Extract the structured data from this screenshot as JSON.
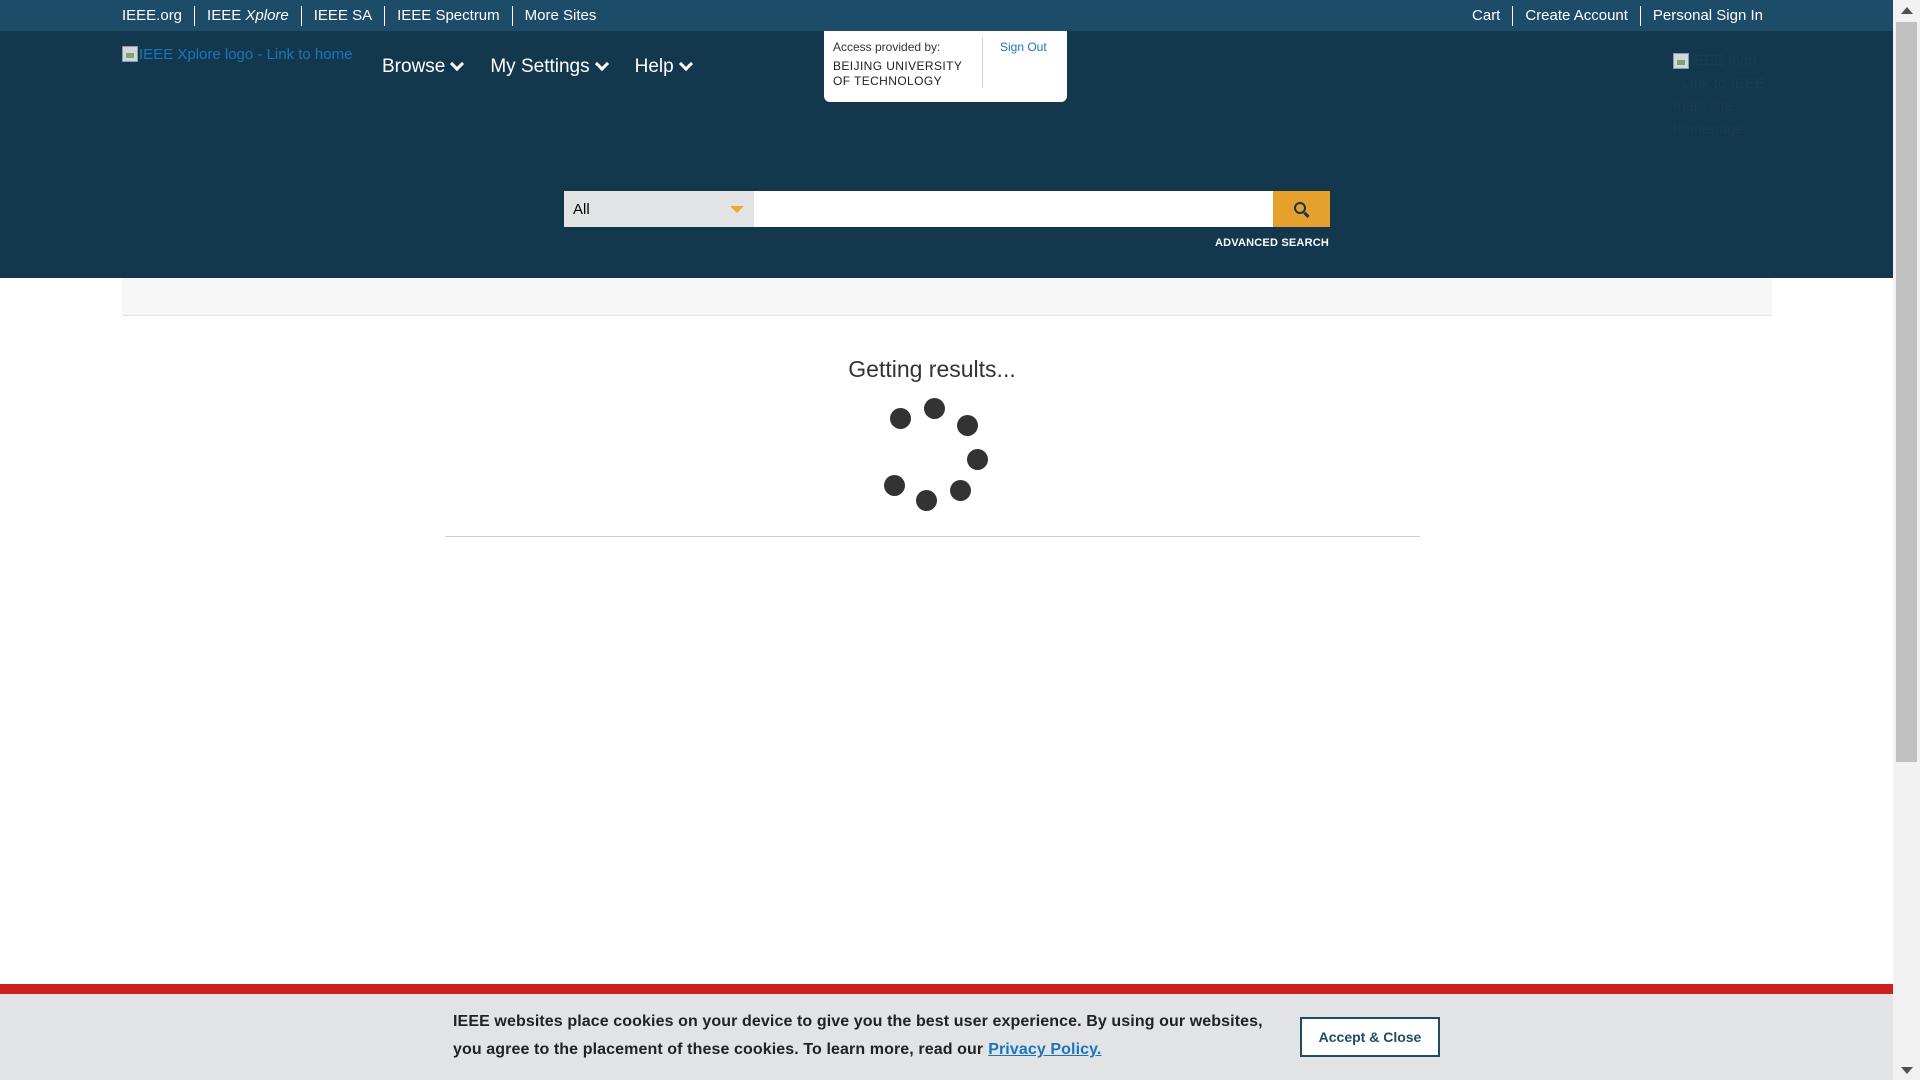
{
  "topbar": {
    "left_links": [
      {
        "label": "IEEE.org"
      },
      {
        "label_prefix": "IEEE ",
        "label_italic": "Xplore"
      },
      {
        "label": "IEEE SA"
      },
      {
        "label": "IEEE Spectrum"
      },
      {
        "label": "More Sites"
      }
    ],
    "right_links": [
      {
        "label": "Cart"
      },
      {
        "label": "Create Account"
      },
      {
        "label": "Personal Sign In"
      }
    ]
  },
  "header": {
    "logo_alt": "IEEE Xplore logo - Link to home",
    "nav": [
      {
        "label": "Browse",
        "icon": "chevron-down-icon"
      },
      {
        "label": "My Settings",
        "icon": "chevron-down-icon"
      },
      {
        "label": "Help",
        "icon": "chevron-down-icon"
      }
    ],
    "access": {
      "label": "Access provided by:",
      "institution_line1": "BEIJING UNIVERSITY",
      "institution_line2": "OF TECHNOLOGY",
      "sign_out": "Sign Out"
    },
    "ieee_logo_alt": "IEEE logo - Link to IEEE main site homepage"
  },
  "search": {
    "scope_selected": "All",
    "input_value": "",
    "button_icon": "search-icon",
    "advanced_label": "ADVANCED SEARCH"
  },
  "main": {
    "loading_text": "Getting results..."
  },
  "cookie": {
    "text": "IEEE websites place cookies on your device to give you the best user experience. By using our websites, you agree to the placement of these cookies. To learn more, read our",
    "link_label": "Privacy Policy.",
    "accept_label": "Accept & Close"
  },
  "colors": {
    "topbar_bg": "#1d4c68",
    "header_bg": "#13384e",
    "search_button": "#e6a12c",
    "link_blue": "#1b75bc",
    "cookie_red": "#cc1f1f",
    "cookie_bg": "#e2e3e5"
  }
}
